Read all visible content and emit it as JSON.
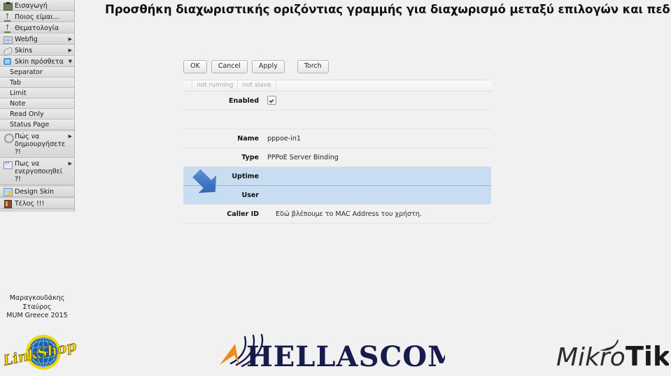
{
  "slide": {
    "title": "Προσθήκη διαχωριστικής οριζόντιας γραμμής για διαχωρισμό μεταξύ επιλογών και πεδίων."
  },
  "sidebar": {
    "items": [
      {
        "label": "Εισαγωγή",
        "icon": "import-icon",
        "arrow": "",
        "indented": false
      },
      {
        "label": "Ποιος είμαι...",
        "icon": "person-icon",
        "arrow": "",
        "indented": false
      },
      {
        "label": "Θεματολογία",
        "icon": "person-icon",
        "arrow": "",
        "indented": false
      },
      {
        "label": "Webfig",
        "icon": "webfig-icon",
        "arrow": "▶",
        "indented": false
      },
      {
        "label": "Skins",
        "icon": "skins-icon",
        "arrow": "▶",
        "indented": false
      },
      {
        "label": "Skin πρόσθετα",
        "icon": "skin-plugin-icon",
        "arrow": "▼",
        "indented": false
      },
      {
        "label": "Separator",
        "icon": "",
        "arrow": "",
        "indented": true
      },
      {
        "label": "Tab",
        "icon": "",
        "arrow": "",
        "indented": true
      },
      {
        "label": "Limit",
        "icon": "",
        "arrow": "",
        "indented": true
      },
      {
        "label": "Note",
        "icon": "",
        "arrow": "",
        "indented": true
      },
      {
        "label": "Read Only",
        "icon": "",
        "arrow": "",
        "indented": true
      },
      {
        "label": "Status Page",
        "icon": "",
        "arrow": "",
        "indented": true
      },
      {
        "label": "Πώς να\nδημιουργήσετε ?!",
        "icon": "gear-icon",
        "arrow": "▶",
        "indented": false
      },
      {
        "label": "Πως να\nενεργοποιηθεί ?!",
        "icon": "vt-icon",
        "arrow": "▶",
        "indented": false
      },
      {
        "label": "Design Skin",
        "icon": "design-icon",
        "arrow": "",
        "indented": false
      },
      {
        "label": "Τέλος !!!",
        "icon": "exit-icon",
        "arrow": "",
        "indented": false
      }
    ]
  },
  "author": {
    "line1": "Μαραγκουδάκης",
    "line2": "Σταύρος",
    "line3": "MUM Greece 2015"
  },
  "form": {
    "buttons": [
      {
        "label": "OK",
        "name": "ok-button"
      },
      {
        "label": "Cancel",
        "name": "cancel-button"
      },
      {
        "label": "Apply",
        "name": "apply-button"
      },
      {
        "label": "Torch",
        "name": "torch-button"
      }
    ],
    "status": {
      "running": "not running",
      "slave": "not slave"
    },
    "rows": [
      {
        "label": "Enabled",
        "value": "",
        "type": "checkbox",
        "checked": true,
        "highlight": "none"
      },
      {
        "label": "",
        "value": "",
        "type": "blank",
        "highlight": "none"
      },
      {
        "label": "Name",
        "value": "pppoe-in1",
        "type": "text",
        "highlight": "none"
      },
      {
        "label": "Type",
        "value": "PPPoE Server Binding",
        "type": "text",
        "highlight": "none"
      },
      {
        "label": "Uptime",
        "value": "",
        "type": "text",
        "highlight": "first"
      },
      {
        "label": "User",
        "value": "",
        "type": "text",
        "highlight": "last"
      },
      {
        "label": "Caller ID",
        "value": "Εδώ βλέπουμε το MAC Address του χρήστη.",
        "type": "note",
        "highlight": "none"
      }
    ]
  },
  "logos": {
    "linkshop": "LinkShop",
    "hellascom": "HELLASCOM",
    "mikrotik_part1": "Mikro",
    "mikrotik_part2": "Tik"
  },
  "colors": {
    "accent_arrow": "#3b72c4",
    "highlight_row": "#c8ddf2",
    "sidebar_bg": "#d9d9d9",
    "hellascom_navy": "#161b4c",
    "hellascom_orange": "#f08a1e",
    "linkshop_yellow": "#f5d800",
    "linkshop_blue": "#1a5fa8"
  }
}
